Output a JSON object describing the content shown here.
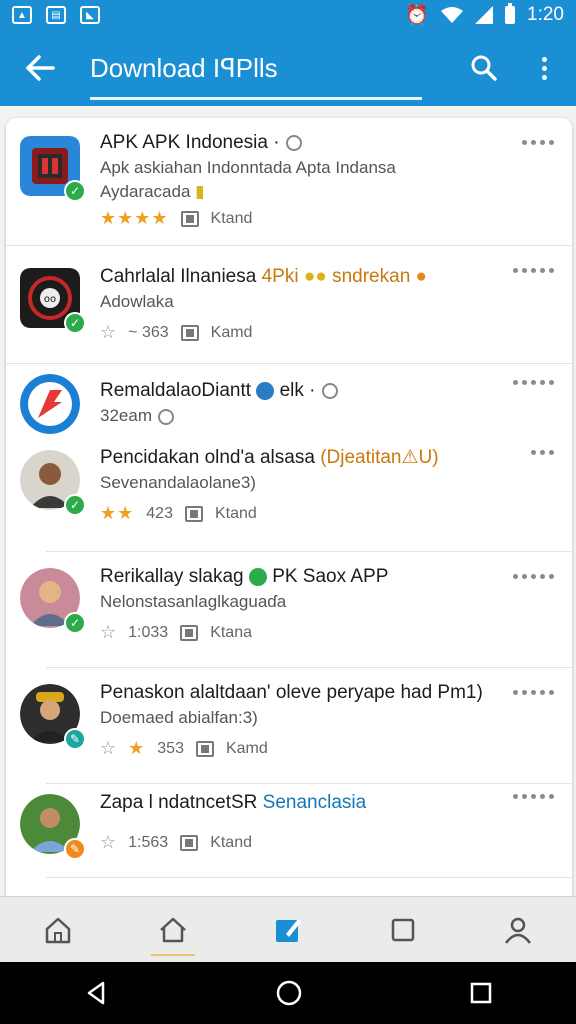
{
  "status_bar": {
    "time": "1:20"
  },
  "app_bar": {
    "title": "Download IꟼPlls"
  },
  "items": [
    {
      "line1_main": "APK APK Indonesia",
      "line1_extra": "·",
      "line2": "Apk askiahan Indonntada  Apta Indansa",
      "line3": "Aydaracada",
      "rating": "★★★★",
      "meta_label": "Ktand",
      "badge": "green"
    },
    {
      "line1_main": "Cahrlalal Ilnaniesa",
      "line1_accent": "4Pki",
      "line1_tail": "sndrekan",
      "line2": "Adowlaka",
      "count": "363",
      "meta_label": "Kamd",
      "badge": "green"
    },
    {
      "line1_main": "RemaldalaoDiantt",
      "line1_tail": "elk ·",
      "line2": "32eam",
      "badge": "none"
    },
    {
      "line1_main": "Pencidakan olnd'a alsasa",
      "line1_accent": "(Djeatitan⚠U)",
      "line2": "Sevenandalaolane3)",
      "rating": "★★",
      "count": "423",
      "meta_label": "Ktand",
      "badge": "green"
    },
    {
      "line1_main": "Rerikallay slakag",
      "line1_tail": "PK Saox APP",
      "line2": "Nelonstasanlaglkaguaɗa",
      "count": "1:033",
      "meta_label": "Ktana",
      "badge": "green"
    },
    {
      "line1_main": "Penaskon alaltdaan' oleve peryape had Pm1)",
      "line2": "Doemaed abialfan:3)",
      "rating": "★",
      "count": "353",
      "meta_label": "Kamd",
      "badge": "teal"
    },
    {
      "line1_main": "Zapa l ndatncetSR",
      "line1_accent": "Senanclasia",
      "count": "1:563",
      "meta_label": "Ktand",
      "badge": "orange"
    }
  ],
  "colors": {
    "primary": "#1a8fd4",
    "verified": "#2daa4a",
    "star": "#f0a020"
  }
}
